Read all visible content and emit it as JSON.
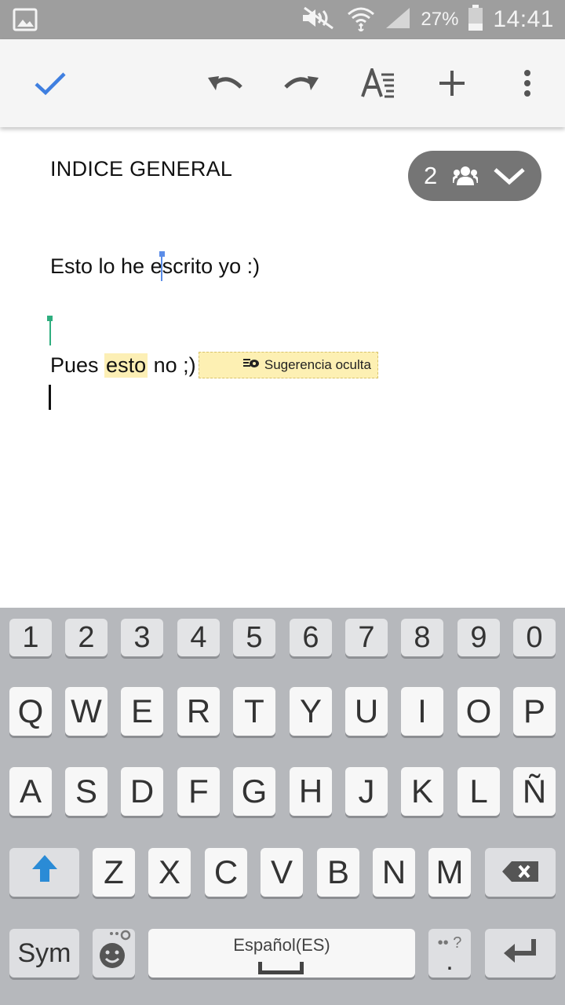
{
  "status_bar": {
    "battery": "27%",
    "time": "14:41"
  },
  "toolbar": {
    "icons": [
      "check-icon",
      "undo-icon",
      "redo-icon",
      "text-format-icon",
      "add-icon",
      "more-vert-icon"
    ],
    "accent_color": "#3f7fe0"
  },
  "document": {
    "title": "INDICE GENERAL",
    "collaborators_count": "2",
    "line1_before_cursor": "Esto lo he ",
    "line1_after_cursor": "escrito yo :)",
    "line2_start": "Pues ",
    "line2_highlight": "esto",
    "line2_end": " no ;)",
    "suggestion_label": "Sugerencia oculta",
    "highlight_color": "#fcefb5"
  },
  "keyboard": {
    "numbers": [
      "1",
      "2",
      "3",
      "4",
      "5",
      "6",
      "7",
      "8",
      "9",
      "0"
    ],
    "row1": [
      "Q",
      "W",
      "E",
      "R",
      "T",
      "Y",
      "U",
      "I",
      "O",
      "P"
    ],
    "row2": [
      "A",
      "S",
      "D",
      "F",
      "G",
      "H",
      "J",
      "K",
      "L",
      "Ñ"
    ],
    "row3": [
      "Z",
      "X",
      "C",
      "V",
      "B",
      "N",
      "M"
    ],
    "sym_label": "Sym",
    "space_label": "Español(ES)",
    "period": ".",
    "extra_chars": "•• ?",
    "shift_color": "#2a8bd6"
  }
}
